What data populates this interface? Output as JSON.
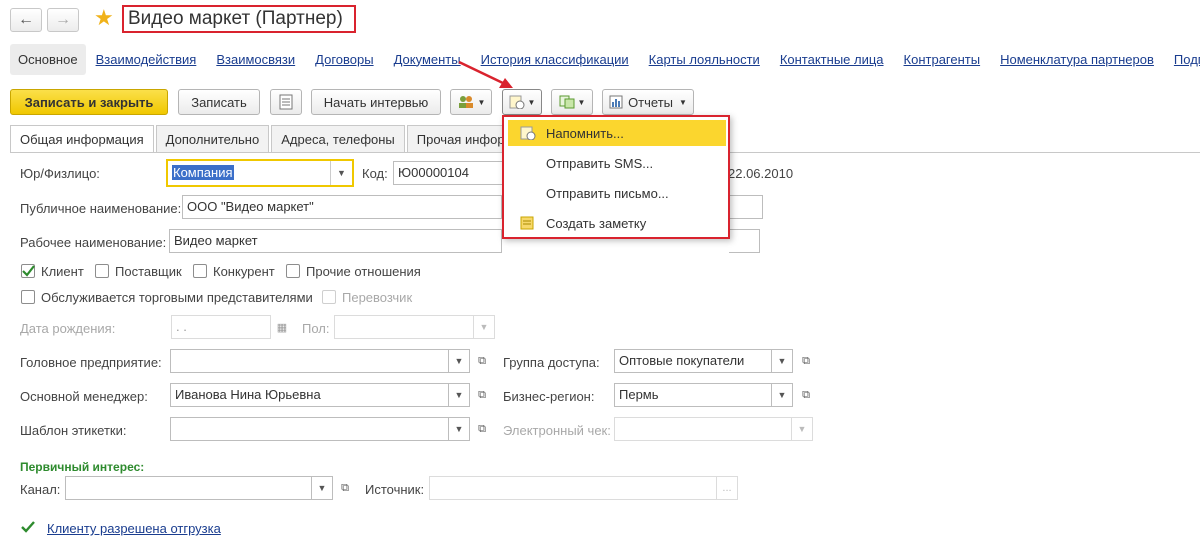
{
  "window": {
    "title": "Видео маркет (Партнер)"
  },
  "navlinks": {
    "active": "Основное",
    "items": [
      "Взаимодействия",
      "Взаимосвязи",
      "Договоры",
      "Документы",
      "История классификации",
      "Карты лояльности",
      "Контактные лица",
      "Контрагенты",
      "Номенклатура партнеров",
      "Подпис"
    ]
  },
  "toolbar": {
    "save_close": "Записать и закрыть",
    "save": "Записать",
    "start_interview": "Начать интервью",
    "reports": "Отчеты"
  },
  "tabs": [
    "Общая информация",
    "Дополнительно",
    "Адреса, телефоны",
    "Прочая информ"
  ],
  "menu": {
    "items": [
      "Напомнить...",
      "Отправить SMS...",
      "Отправить письмо...",
      "Создать заметку"
    ],
    "selected_index": 0
  },
  "form": {
    "legal_label": "Юр/Физлицо:",
    "legal_value": "Компания",
    "code_label": "Код:",
    "code_value": "Ю00000104",
    "date_value": "22.06.2010",
    "public_name_label": "Публичное наименование:",
    "public_name_value": "ООО \"Видео маркет\"",
    "work_name_label": "Рабочее наименование:",
    "work_name_value": "Видео маркет",
    "cb_client": "Клиент",
    "cb_client_checked": true,
    "cb_supplier": "Поставщик",
    "cb_competitor": "Конкурент",
    "cb_other": "Прочие отношения",
    "cb_reps": "Обслуживается торговыми представителями",
    "cb_carrier": "Перевозчик",
    "birth_label": "Дата рождения:",
    "birth_value": ".   .",
    "gender_label": "Пол:",
    "head_label": "Головное предприятие:",
    "access_label": "Группа доступа:",
    "access_value": "Оптовые покупатели",
    "manager_label": "Основной менеджер:",
    "manager_value": "Иванова Нина Юрьевна",
    "region_label": "Бизнес-регион:",
    "region_value": "Пермь",
    "template_label": "Шаблон этикетки:",
    "receipt_label": "Электронный чек:",
    "interest_header": "Первичный интерес:",
    "channel_label": "Канал:",
    "source_label": "Источник:",
    "shipment_link": "Клиенту разрешена отгрузка"
  },
  "colors": {
    "accent_red": "#d9232e",
    "primary_yellow": "#f0c800",
    "link_blue": "#1a3d8f",
    "green": "#2e8b2e"
  }
}
